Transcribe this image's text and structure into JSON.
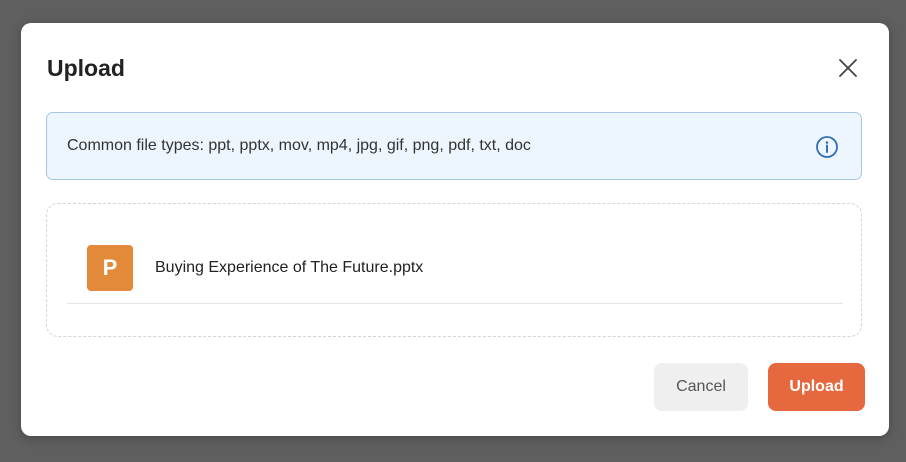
{
  "modal": {
    "title": "Upload",
    "close_icon": "close-icon"
  },
  "info_banner": {
    "text": "Common file types: ppt, pptx, mov, mp4, jpg, gif, png, pdf, txt, doc",
    "icon": "info-icon",
    "accent_color": "#2f6fb5"
  },
  "files": [
    {
      "type_letter": "P",
      "name": "Buying Experience of The Future.pptx",
      "icon_color": "#e38a3a"
    }
  ],
  "footer": {
    "cancel_label": "Cancel",
    "upload_label": "Upload",
    "upload_color": "#e5683f"
  }
}
